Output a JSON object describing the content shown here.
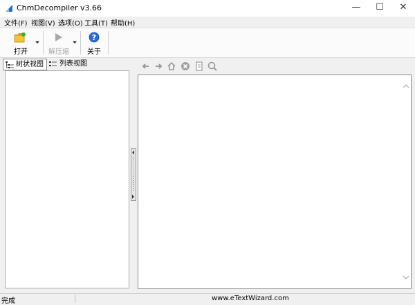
{
  "window": {
    "title": "ChmDecompiler v3.66",
    "minimize_glyph": "—",
    "maximize_glyph": "☐",
    "close_glyph": "✕"
  },
  "menu": [
    {
      "label": "文件(F)"
    },
    {
      "label": "视图(V)"
    },
    {
      "label": "选项(O)"
    },
    {
      "label": "工具(T)"
    },
    {
      "label": "帮助(H)"
    }
  ],
  "toolbar": {
    "open_label": "打开",
    "decompress_label": "解压缩",
    "about_label": "关于"
  },
  "tabs": [
    {
      "label": "树状视图",
      "icon": "tree-view-icon"
    },
    {
      "label": "列表视图",
      "icon": "list-view-icon"
    }
  ],
  "nav_icons": [
    "back-arrow-icon",
    "forward-arrow-icon",
    "home-icon",
    "stop-icon",
    "page-icon",
    "zoom-icon"
  ],
  "status": {
    "text": "完成",
    "website": "www.eTextWizard.com"
  },
  "colors": {
    "accent_blue": "#1e6fd0",
    "disabled_gray": "#a8a8a8",
    "folder_yellow": "#f2c53d"
  }
}
